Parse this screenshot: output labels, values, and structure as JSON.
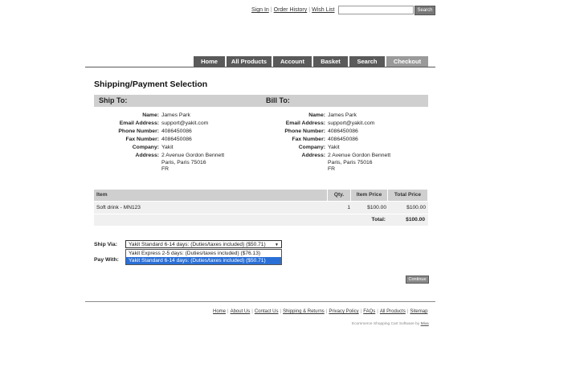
{
  "top": {
    "links": [
      "Sign In",
      "Order History",
      "Wish List"
    ],
    "search_value": "",
    "search_button": "Search"
  },
  "nav": {
    "tabs": [
      "Home",
      "All Products",
      "Account",
      "Basket",
      "Search",
      "Checkout"
    ],
    "active": "Checkout"
  },
  "page_title": "Shipping/Payment Selection",
  "ship_to": {
    "heading": "Ship To:",
    "name_label": "Name:",
    "name": "James Park",
    "email_label": "Email Address:",
    "email": "support@yakit.com",
    "phone_label": "Phone Number:",
    "phone": "4086450086",
    "fax_label": "Fax Number:",
    "fax": "4086450086",
    "company_label": "Company:",
    "company": "Yakit",
    "address_label": "Address:",
    "address_line1": "2 Avenue Gordon Bennett",
    "address_line2": "Paris, Paris 75016",
    "address_line3": "FR"
  },
  "bill_to": {
    "heading": "Bill To:",
    "name_label": "Name:",
    "name": "James Park",
    "email_label": "Email Address:",
    "email": "support@yakit.com",
    "phone_label": "Phone Number:",
    "phone": "4086450086",
    "fax_label": "Fax Number:",
    "fax": "4086450086",
    "company_label": "Company:",
    "company": "Yakit",
    "address_label": "Address:",
    "address_line1": "2 Avenue Gordon Bennett",
    "address_line2": "Paris, Paris 75016",
    "address_line3": "FR"
  },
  "items_table": {
    "headers": [
      "Item",
      "Qty.",
      "Item Price",
      "Total Price"
    ],
    "rows": [
      {
        "item": "Soft drink - MN123",
        "qty": "1",
        "item_price": "$100.00",
        "total_price": "$100.00"
      }
    ],
    "total_label": "Total:",
    "total_value": "$100.00"
  },
  "shipping": {
    "ship_via_label": "Ship Via:",
    "selected": "Yakit Standard 6-14 days: (Duties/taxes included) ($50.71)",
    "options": [
      "Yakit Express 2-5 days: (Duties/taxes included) ($76.13)",
      "Yakit Standard 6-14 days: (Duties/taxes included) ($50.71)"
    ],
    "pay_with_label": "Pay With:"
  },
  "continue_button": "Continue",
  "footer": {
    "links": [
      "Home",
      "About Us",
      "Contact Us",
      "Shipping & Returns",
      "Privacy Policy",
      "FAQs",
      "All Products",
      "Sitemap"
    ],
    "credit_text": "Ecommerce Shopping Cart Software by",
    "credit_link": "Miva"
  },
  "colors": {
    "nav_tab": "#5a5a5a",
    "nav_tab_active": "#9a9a9a",
    "section_bar": "#cfcfcf",
    "selected_option": "#2a6fd6"
  }
}
